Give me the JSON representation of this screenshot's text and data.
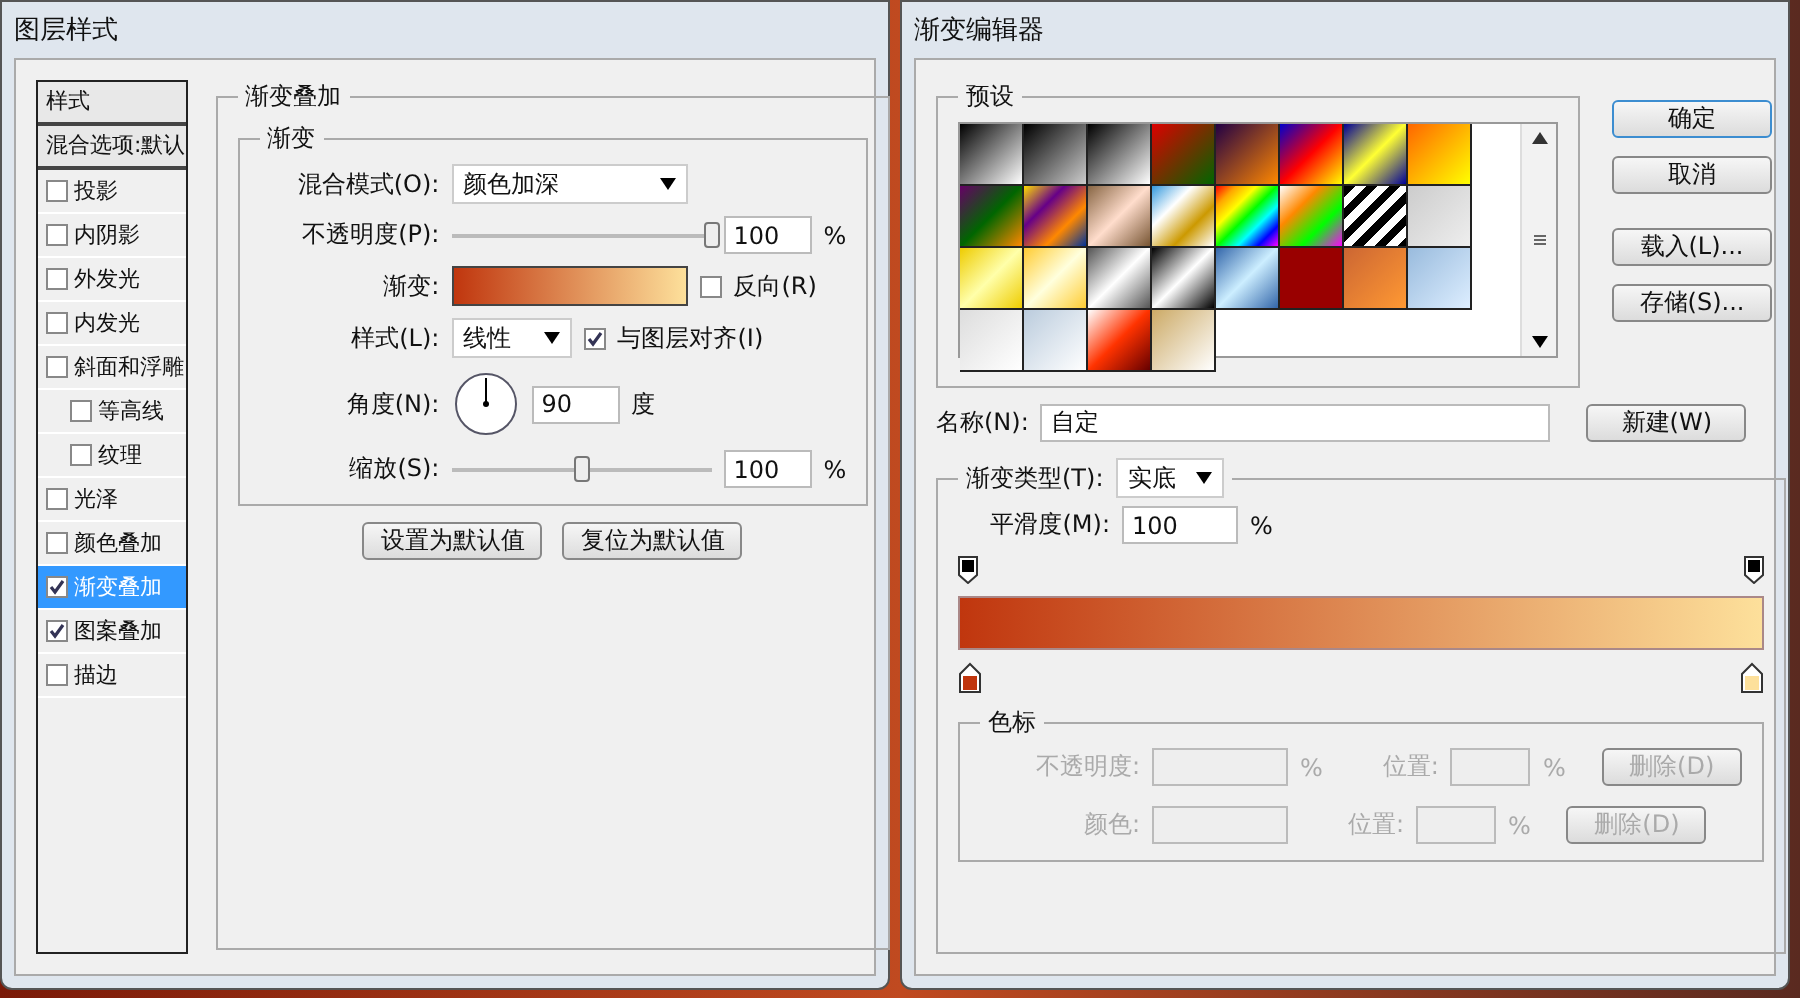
{
  "layer_style": {
    "title": "图层样式",
    "sidebar": [
      {
        "kind": "header",
        "label": "样式",
        "selected": false
      },
      {
        "kind": "header",
        "label": "混合选项:默认",
        "selected": false
      },
      {
        "kind": "check",
        "label": "投影",
        "checked": false,
        "selected": false
      },
      {
        "kind": "check",
        "label": "内阴影",
        "checked": false,
        "selected": false
      },
      {
        "kind": "check",
        "label": "外发光",
        "checked": false,
        "selected": false
      },
      {
        "kind": "check",
        "label": "内发光",
        "checked": false,
        "selected": false
      },
      {
        "kind": "check",
        "label": "斜面和浮雕",
        "checked": false,
        "selected": false,
        "children": [
          {
            "kind": "check",
            "label": "等高线",
            "checked": false,
            "selected": false
          },
          {
            "kind": "check",
            "label": "纹理",
            "checked": false,
            "selected": false
          }
        ]
      },
      {
        "kind": "check",
        "label": "光泽",
        "checked": false,
        "selected": false
      },
      {
        "kind": "check",
        "label": "颜色叠加",
        "checked": false,
        "selected": false
      },
      {
        "kind": "check",
        "label": "渐变叠加",
        "checked": true,
        "selected": true
      },
      {
        "kind": "check",
        "label": "图案叠加",
        "checked": true,
        "selected": false
      },
      {
        "kind": "check",
        "label": "描边",
        "checked": false,
        "selected": false
      }
    ],
    "section_title": "渐变叠加",
    "group_title": "渐变",
    "blend_mode": {
      "label": "混合模式(O):",
      "value": "颜色加深"
    },
    "opacity": {
      "label": "不透明度(P):",
      "level": 1,
      "value": "100",
      "unit": "%"
    },
    "gradient": {
      "label": "渐变:",
      "reverse": {
        "label": "反向(R)",
        "checked": false
      }
    },
    "style": {
      "label": "样式(L):",
      "value": "线性",
      "align": {
        "label": "与图层对齐(I)",
        "checked": true
      }
    },
    "angle": {
      "label": "角度(N):",
      "value": "90",
      "unit": "度"
    },
    "scale": {
      "label": "缩放(S):",
      "level": 0.5,
      "value": "100",
      "unit": "%"
    },
    "buttons": [
      "设置为默认值",
      "复位为默认值"
    ]
  },
  "gradient_editor": {
    "title": "渐变编辑器",
    "presets_title": "预设",
    "buttons": [
      "确定",
      "取消",
      "载入(L)...",
      "存储(S)..."
    ],
    "name": {
      "label": "名称(N):",
      "value": "自定"
    },
    "new_button": "新建(W)",
    "type": {
      "label": "渐变类型(T):",
      "value": "实底"
    },
    "smoothness": {
      "label": "平滑度(M):",
      "value": "100",
      "unit": "%"
    },
    "color_stops": [
      {
        "color": "#c0360e"
      },
      {
        "color": "#fde09b"
      }
    ],
    "stops_group": {
      "title": "色标",
      "opacity": {
        "label": "不透明度:",
        "unit": "%",
        "position_label": "位置:",
        "position_unit": "%",
        "delete": "删除(D)"
      },
      "color": {
        "label": "颜色:",
        "position_label": "位置:",
        "position_unit": "%",
        "delete": "删除(D)"
      }
    }
  }
}
